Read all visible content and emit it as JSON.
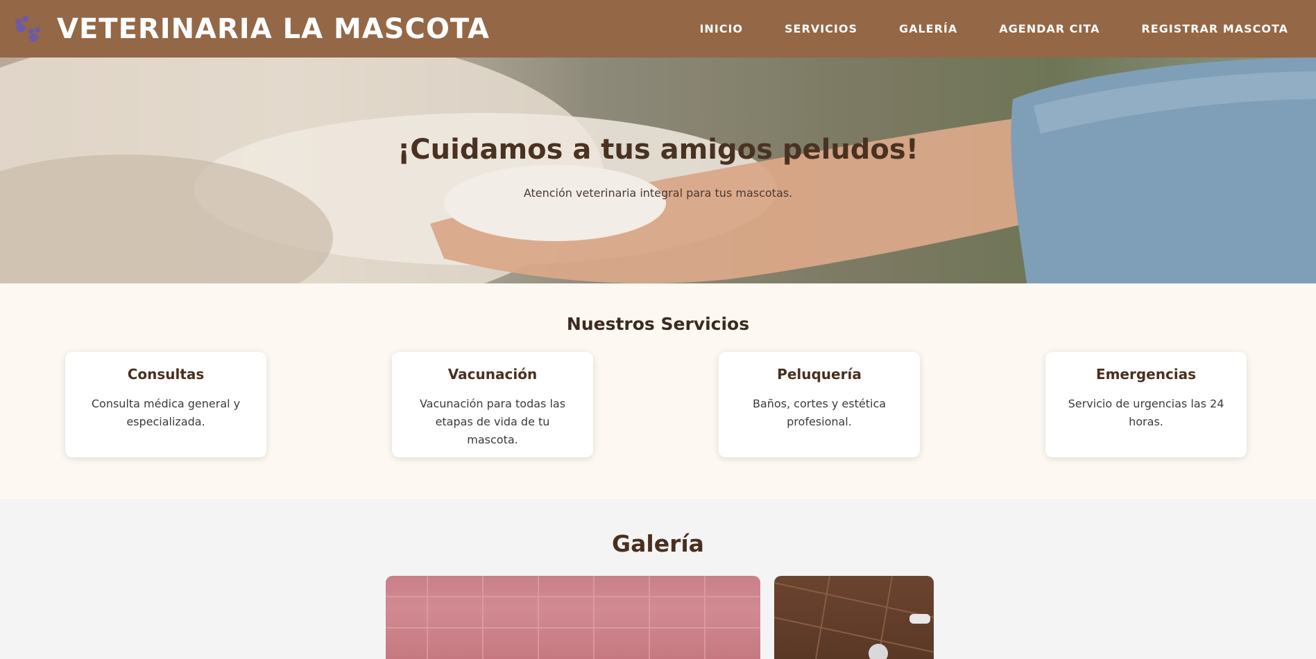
{
  "header": {
    "logo_icon": "paw-icon",
    "title": "VETERINARIA LA MASCOTA",
    "nav": [
      {
        "label": "INICIO"
      },
      {
        "label": "SERVICIOS"
      },
      {
        "label": "GALERÍA"
      },
      {
        "label": "AGENDAR CITA"
      },
      {
        "label": "REGISTRAR MASCOTA"
      }
    ]
  },
  "hero": {
    "title": "¡Cuidamos a tus amigos peludos!",
    "subtitle": "Atención veterinaria integral para tus mascotas."
  },
  "services": {
    "title": "Nuestros Servicios",
    "cards": [
      {
        "title": "Consultas",
        "text": "Consulta médica general y especializada."
      },
      {
        "title": "Vacunación",
        "text": "Vacunación para todas las etapas de vida de tu mascota."
      },
      {
        "title": "Peluquería",
        "text": "Baños, cortes y estética profesional."
      },
      {
        "title": "Emergencias",
        "text": "Servicio de urgencias las 24 horas."
      }
    ]
  },
  "gallery": {
    "title": "Galería"
  },
  "colors": {
    "header_bg": "#946746",
    "accent_text": "#4a2f1f",
    "services_bg": "#fdf8f2"
  }
}
